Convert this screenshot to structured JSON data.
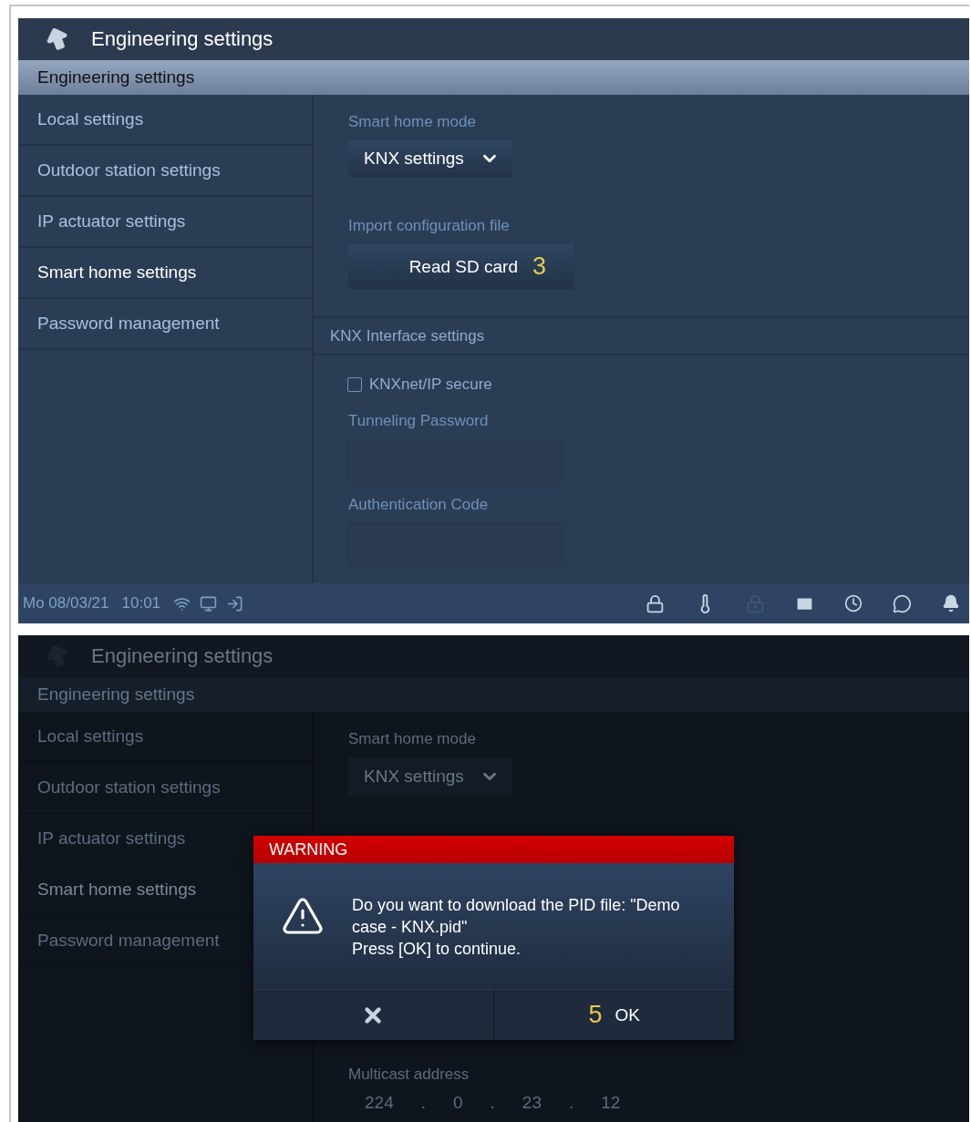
{
  "screens": [
    {
      "dimmed": false,
      "title": "Engineering settings",
      "header": "Engineering settings",
      "sidebar": {
        "items": [
          {
            "label": "Local settings",
            "selected": false
          },
          {
            "label": "Outdoor station settings",
            "selected": false
          },
          {
            "label": "IP actuator settings",
            "selected": false
          },
          {
            "label": "Smart home settings",
            "selected": true
          },
          {
            "label": "Password management",
            "selected": false
          }
        ]
      },
      "content": [
        {
          "kind": "label",
          "text": "Smart home mode"
        },
        {
          "kind": "dropdown",
          "value": "KNX settings"
        },
        {
          "kind": "label",
          "text": "Import configuration file"
        },
        {
          "kind": "button",
          "label": "Read SD card",
          "callout": "3"
        },
        {
          "kind": "section",
          "text": "KNX Interface settings"
        },
        {
          "kind": "checkbox",
          "label": "KNXnet/IP secure",
          "checked": false
        },
        {
          "kind": "label",
          "text": "Tunneling Password"
        },
        {
          "kind": "field"
        },
        {
          "kind": "label",
          "text": "Authentication Code"
        },
        {
          "kind": "field"
        }
      ],
      "status_bar": {
        "date": "Mo 08/03/21",
        "time": "10:01"
      }
    },
    {
      "dimmed": true,
      "title": "Engineering settings",
      "header": "Engineering settings",
      "sidebar": {
        "items": [
          {
            "label": "Local settings",
            "selected": false
          },
          {
            "label": "Outdoor station settings",
            "selected": false
          },
          {
            "label": "IP actuator settings",
            "selected": false
          },
          {
            "label": "Smart home settings",
            "selected": true
          },
          {
            "label": "Password management",
            "selected": false
          }
        ]
      },
      "content": [
        {
          "kind": "label",
          "text": "Smart home mode"
        },
        {
          "kind": "dropdown",
          "value": "KNX settings"
        }
      ],
      "lower_content": [
        {
          "kind": "label",
          "text": "Multicast address"
        },
        {
          "kind": "ip",
          "octets": [
            "224",
            "0",
            "23",
            "12"
          ],
          "separator": "."
        }
      ],
      "dialog": {
        "title": "WARNING",
        "message": "Do you want to download the PID file: \"Demo case - KNX.pid\"\nPress [OK] to continue.",
        "ok_label": "OK",
        "callout": "5"
      }
    }
  ]
}
